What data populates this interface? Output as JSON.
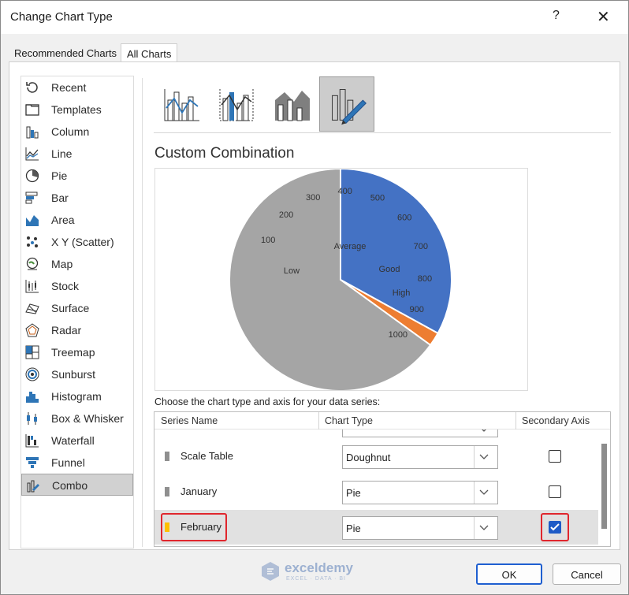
{
  "window": {
    "title": "Change Chart Type",
    "help": "?",
    "close": "✕"
  },
  "tabs": [
    {
      "label": "Recommended Charts"
    },
    {
      "label": "All Charts"
    }
  ],
  "sidebar": {
    "items": [
      {
        "label": "Recent",
        "icon": "recent-icon"
      },
      {
        "label": "Templates",
        "icon": "templates-icon"
      },
      {
        "label": "Column",
        "icon": "column-chart-icon"
      },
      {
        "label": "Line",
        "icon": "line-chart-icon"
      },
      {
        "label": "Pie",
        "icon": "pie-chart-icon"
      },
      {
        "label": "Bar",
        "icon": "bar-chart-icon"
      },
      {
        "label": "Area",
        "icon": "area-chart-icon"
      },
      {
        "label": "X Y (Scatter)",
        "icon": "scatter-chart-icon"
      },
      {
        "label": "Map",
        "icon": "map-chart-icon"
      },
      {
        "label": "Stock",
        "icon": "stock-chart-icon"
      },
      {
        "label": "Surface",
        "icon": "surface-chart-icon"
      },
      {
        "label": "Radar",
        "icon": "radar-chart-icon"
      },
      {
        "label": "Treemap",
        "icon": "treemap-chart-icon"
      },
      {
        "label": "Sunburst",
        "icon": "sunburst-chart-icon"
      },
      {
        "label": "Histogram",
        "icon": "histogram-chart-icon"
      },
      {
        "label": "Box & Whisker",
        "icon": "box-whisker-chart-icon"
      },
      {
        "label": "Waterfall",
        "icon": "waterfall-chart-icon"
      },
      {
        "label": "Funnel",
        "icon": "funnel-chart-icon"
      },
      {
        "label": "Combo",
        "icon": "combo-chart-icon"
      }
    ],
    "selected": "Combo"
  },
  "subtypes": {
    "icons": [
      "clustered-column-line-icon",
      "clustered-column-line-secondary-axis-icon",
      "stacked-area-clustered-column-icon",
      "custom-combination-icon"
    ],
    "selected_index": 3
  },
  "section_title": "Custom Combination",
  "chart_data": {
    "type": "pie",
    "slices": [
      {
        "value": 33,
        "color": "#4472c4"
      },
      {
        "value": 2,
        "color": "#ed7d31"
      },
      {
        "value": 65,
        "color": "#a5a5a5"
      }
    ],
    "doughnut_labels": [
      "100",
      "200",
      "300",
      "400",
      "500",
      "600",
      "700",
      "800",
      "900",
      "1000"
    ],
    "category_labels": [
      "Low",
      "Average",
      "Good",
      "High"
    ]
  },
  "series_prompt": "Choose the chart type and axis for your data series:",
  "grid": {
    "headers": {
      "series": "Series Name",
      "type": "Chart Type",
      "axis": "Secondary Axis"
    },
    "rows": [
      {
        "name": "Scale Table",
        "type": "Doughnut",
        "secondary": false,
        "swatch": "#8f8f8f"
      },
      {
        "name": "January",
        "type": "Pie",
        "secondary": false,
        "swatch": "#8f8f8f"
      },
      {
        "name": "February",
        "type": "Pie",
        "secondary": true,
        "swatch": "#ffc000"
      }
    ]
  },
  "buttons": {
    "ok": "OK",
    "cancel": "Cancel"
  },
  "watermark": {
    "brand": "exceldemy",
    "tagline": "EXCEL · DATA · BI"
  }
}
